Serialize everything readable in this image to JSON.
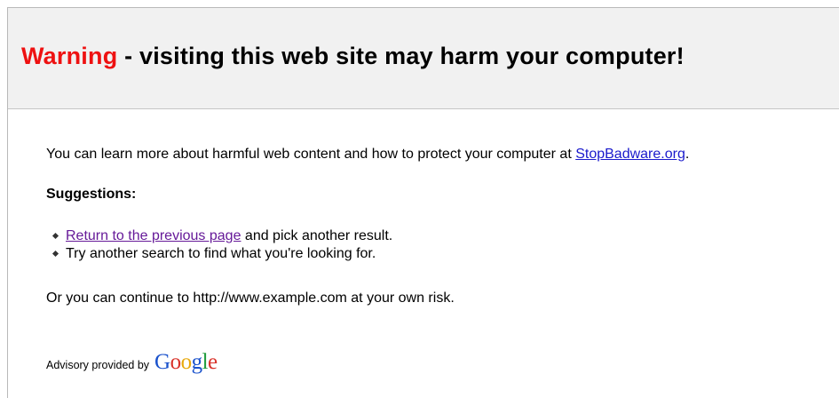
{
  "header": {
    "warning_word": "Warning",
    "warning_rest": " - visiting this web site may harm your computer!",
    "warning_color": "#ee1111"
  },
  "intro": {
    "text": "You can learn more about harmful web content and how to protect your computer at ",
    "link_label": "StopBadware.org",
    "trailing": "."
  },
  "suggestions": {
    "heading": "Suggestions:",
    "items": [
      {
        "link_label": "Return to the previous page",
        "text": " and pick another result."
      },
      {
        "text": "Try another search to find what you're looking for."
      }
    ]
  },
  "continue_text": "Or you can continue to http://www.example.com at your own risk.",
  "advisory": {
    "text": "Advisory provided by",
    "logo": [
      "G",
      "o",
      "o",
      "g",
      "l",
      "e"
    ]
  }
}
